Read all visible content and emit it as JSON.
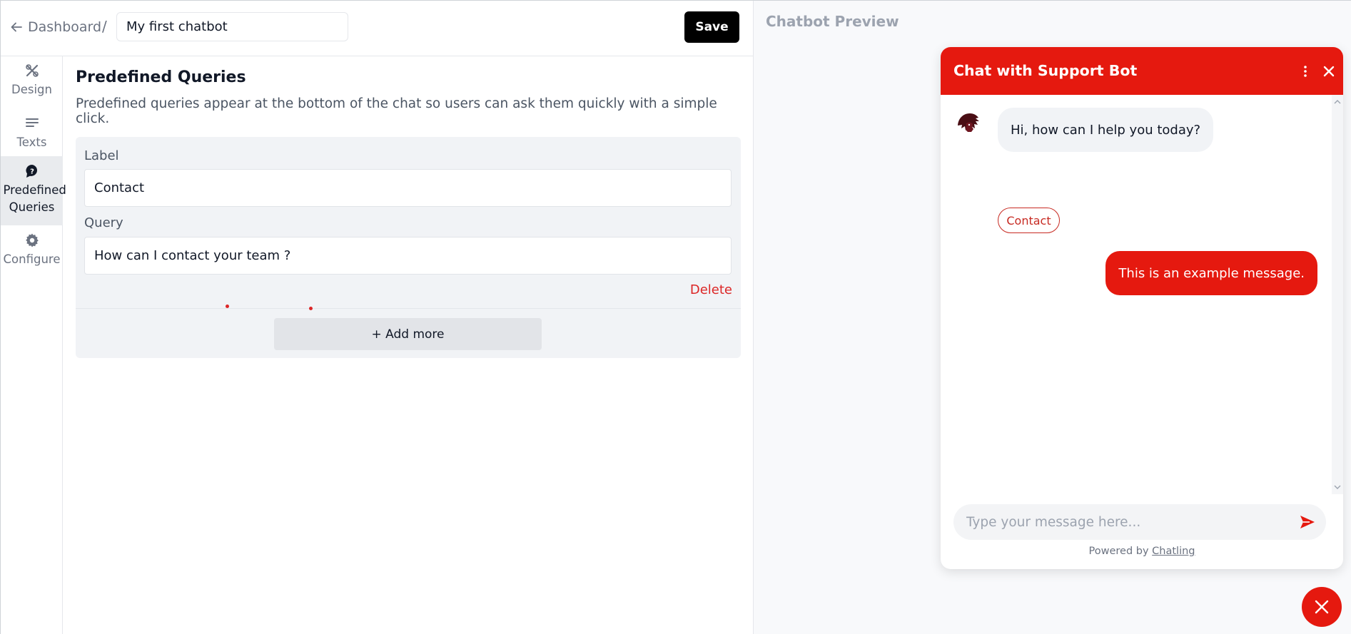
{
  "header": {
    "back_label": "Dashboard",
    "separator": "/",
    "chatbot_name": "My first chatbot",
    "save_label": "Save"
  },
  "sidebar": {
    "items": [
      {
        "label": "Design",
        "icon": "design-tools-icon",
        "active": false
      },
      {
        "label": "Texts",
        "icon": "text-lines-icon",
        "active": false
      },
      {
        "label": "Predefined Queries",
        "icon": "question-bubble-icon",
        "active": true
      },
      {
        "label": "Configure",
        "icon": "gear-icon",
        "active": false
      }
    ]
  },
  "main": {
    "title": "Predefined Queries",
    "description": "Predefined queries appear at the bottom of the chat so users can ask them quickly with a simple click.",
    "query_card": {
      "label_caption": "Label",
      "label_value": "Contact",
      "query_caption": "Query",
      "query_value": "How can I contact your team ?",
      "delete_label": "Delete"
    },
    "add_more_label": "+ Add more"
  },
  "preview": {
    "title": "Chatbot Preview",
    "chat": {
      "header_title": "Chat with Support Bot",
      "bot_message": "Hi, how can I help you today?",
      "query_chip": "Contact",
      "user_message": "This is an example message.",
      "input_placeholder": "Type your message here...",
      "powered_prefix": "Powered by",
      "powered_brand": "Chatling"
    },
    "colors": {
      "accent": "#e5190f",
      "chip_border": "#c72a22"
    }
  }
}
